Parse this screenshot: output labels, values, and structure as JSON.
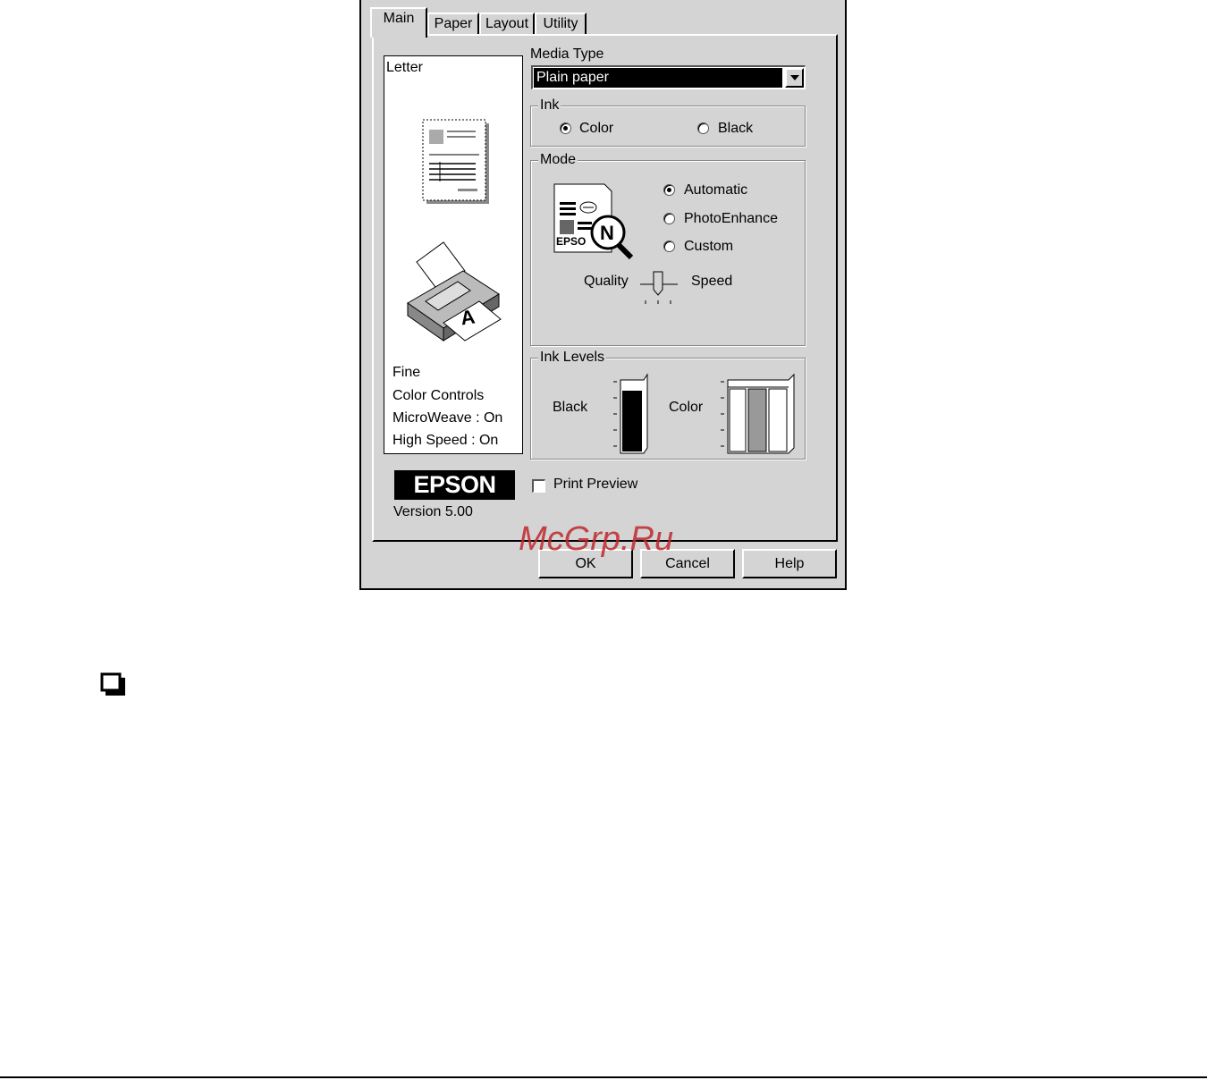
{
  "tabs": [
    {
      "label": "Main"
    },
    {
      "label": "Paper"
    },
    {
      "label": "Layout"
    },
    {
      "label": "Utility"
    }
  ],
  "preview": {
    "paper_size": "Letter",
    "settings": [
      "Fine",
      "Color Controls",
      "MicroWeave : On",
      "High Speed : On"
    ]
  },
  "media_type": {
    "label": "Media Type",
    "value": "Plain paper"
  },
  "ink": {
    "label": "Ink",
    "options": [
      "Color",
      "Black"
    ],
    "selected": "Color"
  },
  "mode": {
    "label": "Mode",
    "options": [
      "Automatic",
      "PhotoEnhance",
      "Custom"
    ],
    "selected": "Automatic",
    "slider_left": "Quality",
    "slider_right": "Speed"
  },
  "ink_levels": {
    "label": "Ink Levels",
    "black_label": "Black",
    "color_label": "Color"
  },
  "brand": {
    "logo": "EPSON",
    "version": "Version 5.00"
  },
  "print_preview": {
    "label": "Print Preview",
    "checked": false
  },
  "buttons": {
    "ok": "OK",
    "cancel": "Cancel",
    "help": "Help"
  },
  "watermark": "McGrp.Ru",
  "colors": {
    "dialog_bg": "#d4d4d4",
    "selection": "#000000",
    "watermark": "#c0282d"
  }
}
